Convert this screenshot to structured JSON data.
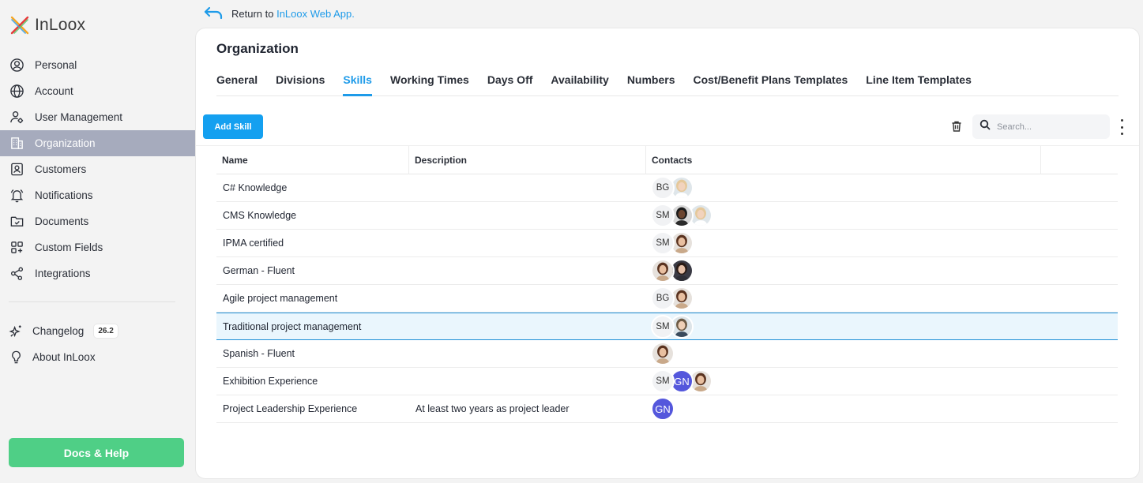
{
  "brand": {
    "name": "InLoox"
  },
  "return": {
    "prefix": "Return to ",
    "link": "InLoox Web App."
  },
  "sidebar": {
    "items": [
      {
        "label": "Personal",
        "icon": "user-circle-icon"
      },
      {
        "label": "Account",
        "icon": "globe-icon"
      },
      {
        "label": "User Management",
        "icon": "users-gear-icon"
      },
      {
        "label": "Organization",
        "icon": "building-icon",
        "active": true
      },
      {
        "label": "Customers",
        "icon": "contact-card-icon"
      },
      {
        "label": "Notifications",
        "icon": "bell-icon"
      },
      {
        "label": "Documents",
        "icon": "folder-check-icon"
      },
      {
        "label": "Custom Fields",
        "icon": "grid-plus-icon"
      },
      {
        "label": "Integrations",
        "icon": "share-nodes-icon"
      }
    ],
    "secondary": [
      {
        "label": "Changelog",
        "icon": "sparkle-icon",
        "badge": "26.2"
      },
      {
        "label": "About InLoox",
        "icon": "lightbulb-icon"
      }
    ],
    "docs_help": "Docs & Help"
  },
  "page": {
    "title": "Organization",
    "tabs": [
      {
        "label": "General"
      },
      {
        "label": "Divisions"
      },
      {
        "label": "Skills",
        "active": true
      },
      {
        "label": "Working Times"
      },
      {
        "label": "Days Off"
      },
      {
        "label": "Availability"
      },
      {
        "label": "Numbers"
      },
      {
        "label": "Cost/Benefit Plans Templates"
      },
      {
        "label": "Line Item Templates"
      }
    ],
    "add_button": "Add Skill",
    "search_placeholder": "Search..."
  },
  "table": {
    "columns": [
      "Name",
      "Description",
      "Contacts"
    ],
    "rows": [
      {
        "name": "C# Knowledge",
        "description": "",
        "contacts": [
          "BG",
          "photo:woman-blonde"
        ]
      },
      {
        "name": "CMS Knowledge",
        "description": "",
        "contacts": [
          "SM",
          "photo:man-dark",
          "photo:woman-blonde"
        ]
      },
      {
        "name": "IPMA certified",
        "description": "",
        "contacts": [
          "SM",
          "photo:woman-brunette"
        ]
      },
      {
        "name": "German - Fluent",
        "description": "",
        "contacts": [
          "photo:woman-brunette",
          "photo:woman-dark"
        ]
      },
      {
        "name": "Agile project management",
        "description": "",
        "contacts": [
          "BG",
          "photo:woman-brunette"
        ]
      },
      {
        "name": "Traditional project management",
        "description": "",
        "contacts": [
          "SM",
          "photo:man-light"
        ],
        "selected": true
      },
      {
        "name": "Spanish - Fluent",
        "description": "",
        "contacts": [
          "photo:woman-brunette"
        ]
      },
      {
        "name": "Exhibition Experience",
        "description": "",
        "contacts": [
          "SM",
          "GN",
          "photo:woman-brunette"
        ]
      },
      {
        "name": "Project Leadership Experience",
        "description": "At least two years as project leader",
        "contacts": [
          "GN"
        ]
      }
    ]
  }
}
